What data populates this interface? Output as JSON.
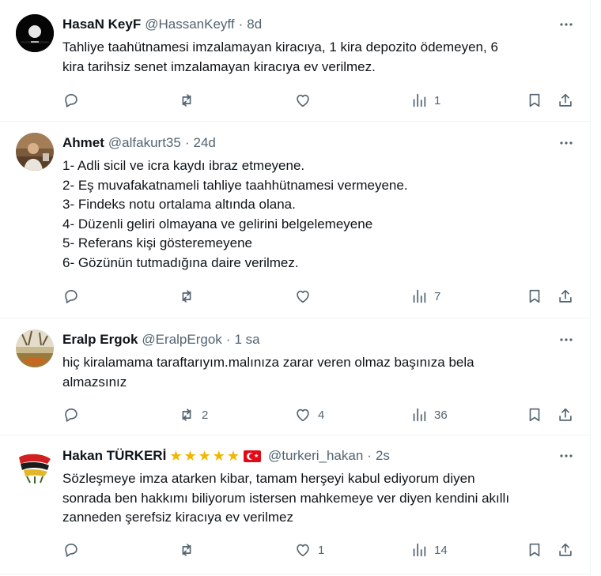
{
  "tweets": [
    {
      "name": "HasaN KeyF",
      "handle": "@HassanKeyff",
      "time": "8d",
      "lines": [
        "Tahliye taahütnamesi imzalamayan kiracıya, 1 kira depozito ödemeyen, 6",
        "kira tarihsiz senet imzalamayan kiracıya ev verilmez."
      ],
      "replies": "",
      "reposts": "",
      "likes": "",
      "views": "1"
    },
    {
      "name": "Ahmet",
      "handle": "@alfakurt35",
      "time": "24d",
      "lines": [
        "1- Adli sicil ve icra kaydı ibraz etmeyene.",
        "2- Eş muvafakatnameli tahliye taahhütnamesi vermeyene.",
        "3- Findeks notu ortalama altında olana.",
        "4- Düzenli geliri olmayana ve gelirini belgelemeyene",
        "5- Referans kişi gösteremeyene",
        "6- Gözünün tutmadığına daire verilmez."
      ],
      "replies": "",
      "reposts": "",
      "likes": "",
      "views": "7"
    },
    {
      "name": "Eralp Ergok",
      "handle": "@EralpErgok",
      "time": "1 sa",
      "lines": [
        "hiç kiralamama taraftarıyım.malınıza zarar veren olmaz başınıza bela",
        "almazsınız"
      ],
      "replies": "",
      "reposts": "2",
      "likes": "4",
      "views": "36"
    },
    {
      "name": "Hakan TÜRKERİ",
      "handle": "@turkeri_hakan",
      "time": "2s",
      "lines": [
        "Sözleşmeye imza atarken kibar, tamam herşeyi kabul ediyorum diyen",
        "sonrada ben hakkımı biliyorum istersen mahkemeye ver diyen kendini akıllı",
        "zanneden şerefsiz kiracıya ev verilmez"
      ],
      "replies": "",
      "reposts": "",
      "likes": "1",
      "views": "14"
    }
  ],
  "separator": "·",
  "icons": {
    "reply": "reply-icon",
    "repost": "repost-icon",
    "like": "like-icon",
    "views": "views-icon",
    "bookmark": "bookmark-icon",
    "share": "share-icon",
    "more": "more-icon",
    "badge_stars": "star-emoji",
    "badge_flag": "turkish-flag-emoji"
  },
  "colors": {
    "text": "#0f1419",
    "secondary": "#536471",
    "divider": "#eff3f4",
    "star": "#f4b400",
    "flag": "#e30a17"
  }
}
